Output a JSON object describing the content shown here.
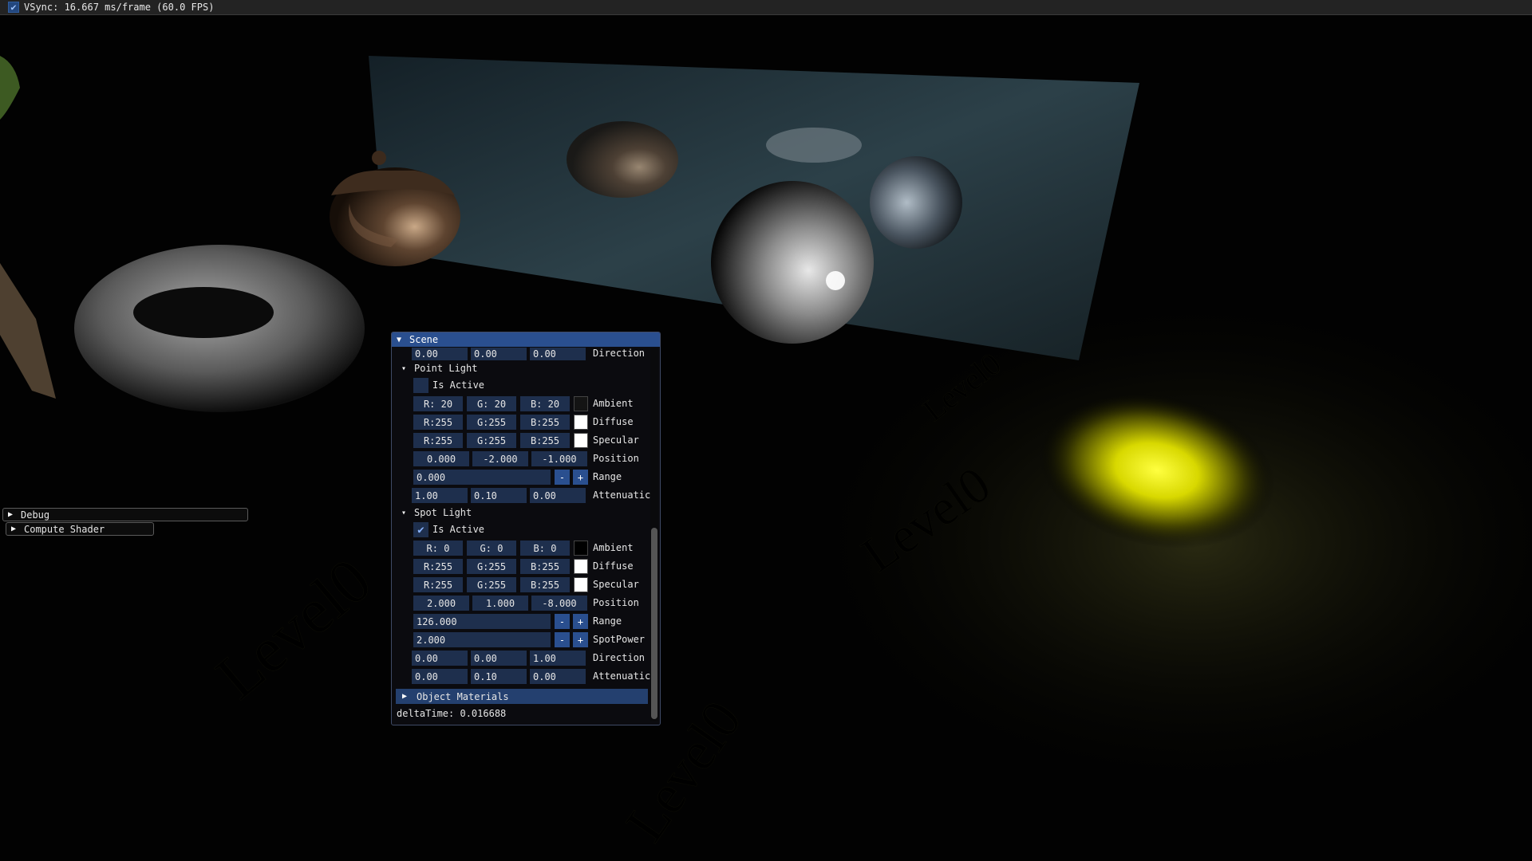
{
  "menubar": {
    "vsync_checked": true,
    "vsync_text": "VSync: 16.667 ms/frame (60.0 FPS)"
  },
  "side_windows": {
    "debug": "Debug",
    "compute": "Compute Shader"
  },
  "scene_window": {
    "title": "Scene",
    "top_direction": {
      "values": [
        "0.00",
        "0.00",
        "0.00"
      ],
      "label": "Direction"
    },
    "point_light": {
      "header": "Point Light",
      "is_active_label": "Is Active",
      "is_active": false,
      "ambient": {
        "values": [
          "R: 20",
          "G: 20",
          "B: 20"
        ],
        "label": "Ambient",
        "color": "#141414"
      },
      "diffuse": {
        "values": [
          "R:255",
          "G:255",
          "B:255"
        ],
        "label": "Diffuse",
        "color": "#ffffff"
      },
      "specular": {
        "values": [
          "R:255",
          "G:255",
          "B:255"
        ],
        "label": "Specular",
        "color": "#ffffff"
      },
      "position": {
        "values": [
          "0.000",
          "-2.000",
          "-1.000"
        ],
        "label": "Position"
      },
      "range": {
        "value": "0.000",
        "label": "Range",
        "minus": "-",
        "plus": "+"
      },
      "attenuation": {
        "values": [
          "1.00",
          "0.10",
          "0.00"
        ],
        "label": "Attenuatic"
      }
    },
    "spot_light": {
      "header": "Spot Light",
      "is_active_label": "Is Active",
      "is_active": true,
      "ambient": {
        "values": [
          "R:  0",
          "G:  0",
          "B:  0"
        ],
        "label": "Ambient",
        "color": "#000000"
      },
      "diffuse": {
        "values": [
          "R:255",
          "G:255",
          "B:255"
        ],
        "label": "Diffuse",
        "color": "#ffffff"
      },
      "specular": {
        "values": [
          "R:255",
          "G:255",
          "B:255"
        ],
        "label": "Specular",
        "color": "#ffffff"
      },
      "position": {
        "values": [
          "2.000",
          "1.000",
          "-8.000"
        ],
        "label": "Position"
      },
      "range": {
        "value": "126.000",
        "label": "Range",
        "minus": "-",
        "plus": "+"
      },
      "spot_power": {
        "value": "2.000",
        "label": "SpotPower",
        "minus": "-",
        "plus": "+"
      },
      "direction": {
        "values": [
          "0.00",
          "0.00",
          "1.00"
        ],
        "label": "Direction"
      },
      "attenuation": {
        "values": [
          "0.00",
          "0.10",
          "0.00"
        ],
        "label": "Attenuatic"
      }
    },
    "object_materials": "Object Materials",
    "delta_time": "deltaTime: 0.016688"
  },
  "scene_text": {
    "level0": "Level0"
  },
  "colors": {
    "accent": "#2a4f8f",
    "field": "#1e2f4d",
    "spotlight": "#ffff00"
  }
}
